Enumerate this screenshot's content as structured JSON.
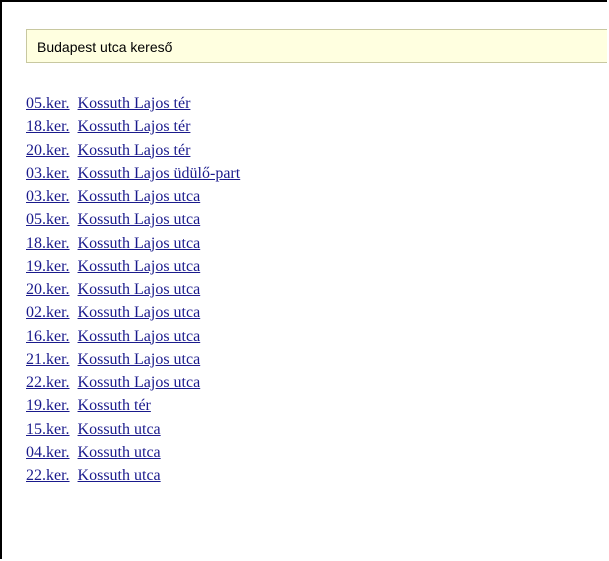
{
  "header": {
    "title": "Budapest utca kereső"
  },
  "results": [
    {
      "district": "05.ker.",
      "street": "Kossuth Lajos tér"
    },
    {
      "district": "18.ker.",
      "street": "Kossuth Lajos tér"
    },
    {
      "district": "20.ker.",
      "street": "Kossuth Lajos tér"
    },
    {
      "district": "03.ker.",
      "street": "Kossuth Lajos üdülő-part"
    },
    {
      "district": "03.ker.",
      "street": "Kossuth Lajos utca"
    },
    {
      "district": "05.ker.",
      "street": "Kossuth Lajos utca"
    },
    {
      "district": "18.ker.",
      "street": "Kossuth Lajos utca"
    },
    {
      "district": "19.ker.",
      "street": "Kossuth Lajos utca"
    },
    {
      "district": "20.ker.",
      "street": "Kossuth Lajos utca"
    },
    {
      "district": "02.ker.",
      "street": "Kossuth Lajos utca"
    },
    {
      "district": "16.ker.",
      "street": "Kossuth Lajos utca"
    },
    {
      "district": "21.ker.",
      "street": "Kossuth Lajos utca"
    },
    {
      "district": "22.ker.",
      "street": "Kossuth Lajos utca"
    },
    {
      "district": "19.ker.",
      "street": "Kossuth tér"
    },
    {
      "district": "15.ker.",
      "street": "Kossuth utca"
    },
    {
      "district": "04.ker.",
      "street": "Kossuth utca"
    },
    {
      "district": "22.ker.",
      "street": "Kossuth utca"
    }
  ],
  "colors": {
    "link": "#1a1a8c",
    "header_bg": "#ffffe0",
    "border": "#000000"
  }
}
